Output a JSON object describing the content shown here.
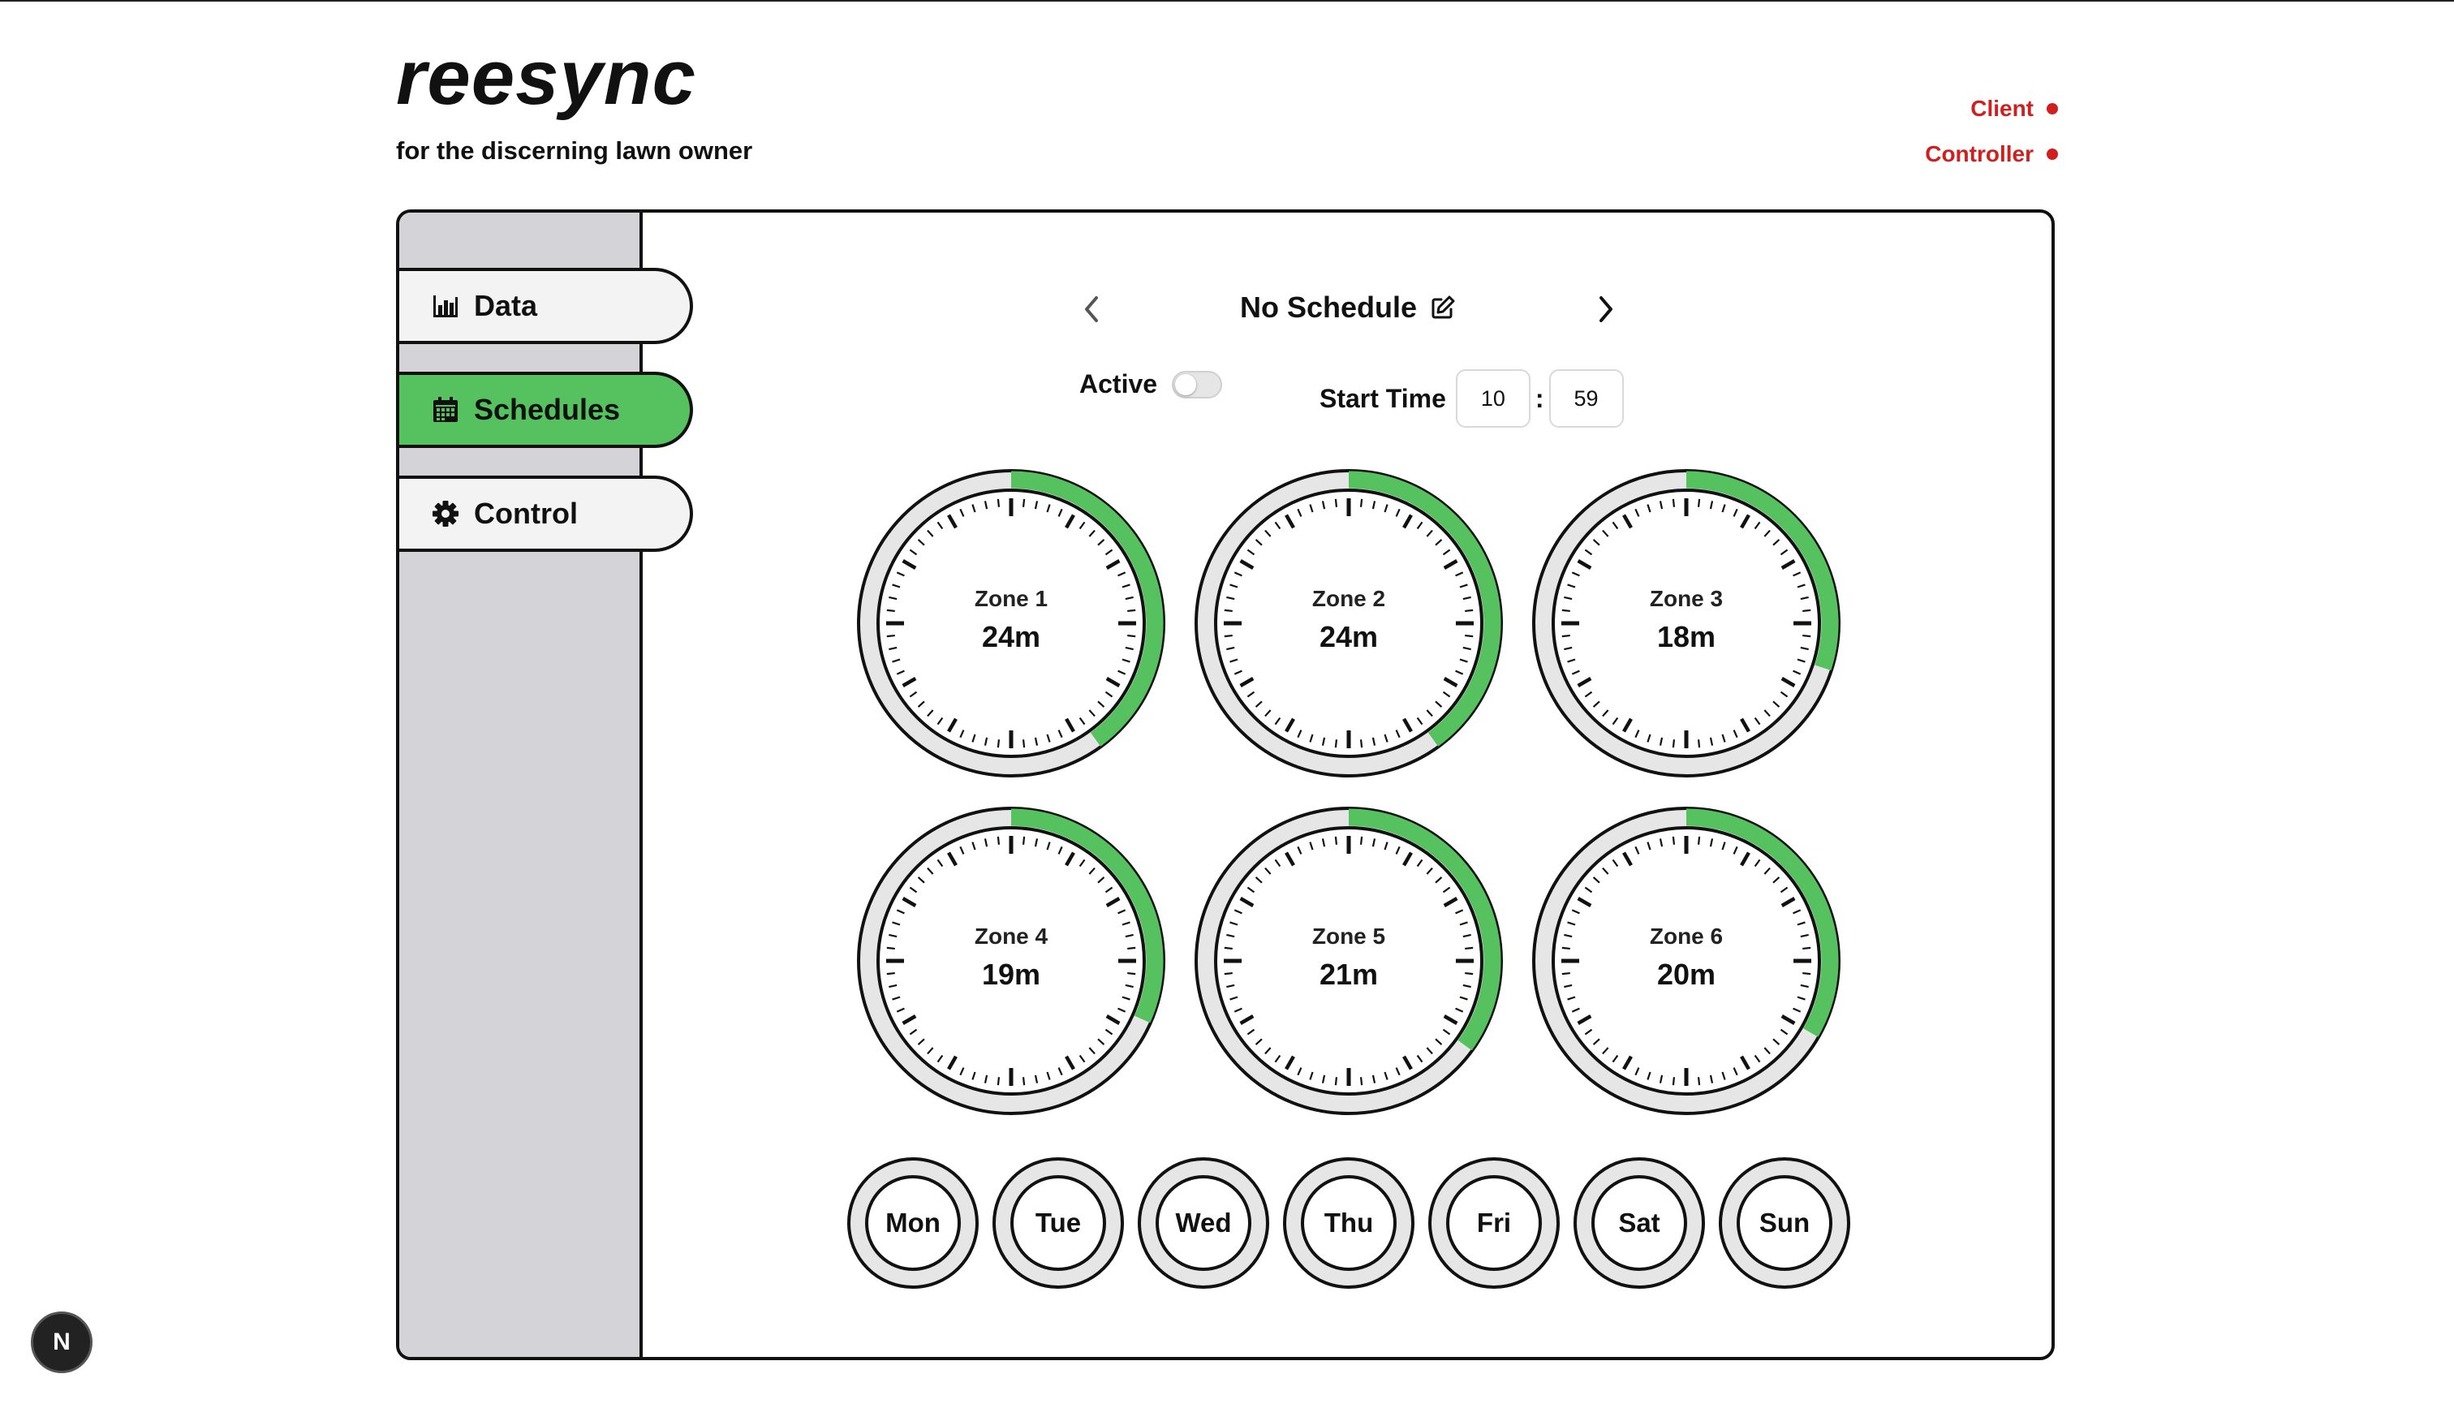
{
  "brand": {
    "title": "reesync",
    "tagline": "for the discerning lawn owner"
  },
  "status": {
    "client": "Client",
    "controller": "Controller",
    "color": "#d11f1f"
  },
  "nav": [
    {
      "label": "Data",
      "icon": "bar-chart-icon",
      "active": false
    },
    {
      "label": "Schedules",
      "icon": "calendar-icon",
      "active": true
    },
    {
      "label": "Control",
      "icon": "gear-icon",
      "active": false
    }
  ],
  "schedule": {
    "title": "No Schedule",
    "active_label": "Active",
    "active": false,
    "start_time_label": "Start Time",
    "start_hour": "10",
    "time_separator": ":",
    "start_minute": "59"
  },
  "zones": [
    {
      "label": "Zone 1",
      "value": "24m",
      "fraction": 0.4
    },
    {
      "label": "Zone 2",
      "value": "24m",
      "fraction": 0.4
    },
    {
      "label": "Zone 3",
      "value": "18m",
      "fraction": 0.3
    },
    {
      "label": "Zone 4",
      "value": "19m",
      "fraction": 0.3167
    },
    {
      "label": "Zone 5",
      "value": "21m",
      "fraction": 0.35
    },
    {
      "label": "Zone 6",
      "value": "20m",
      "fraction": 0.3333
    }
  ],
  "days": [
    "Mon",
    "Tue",
    "Wed",
    "Thu",
    "Fri",
    "Sat",
    "Sun"
  ],
  "badge": "N",
  "colors": {
    "accent": "#56c15f",
    "sidebar": "#d4d3d8",
    "ring": "#e6e6e6"
  }
}
